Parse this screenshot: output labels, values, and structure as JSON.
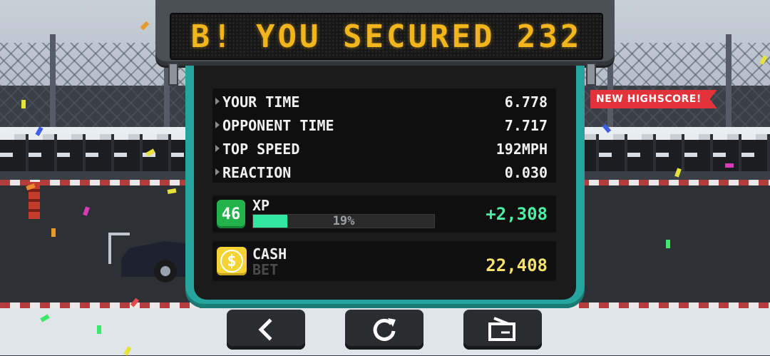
{
  "marquee": {
    "text": "B! YOU SECURED 232"
  },
  "stats": [
    {
      "label": "YOUR TIME",
      "value": "6.778"
    },
    {
      "label": "OPPONENT TIME",
      "value": "7.717"
    },
    {
      "label": "TOP SPEED",
      "value": "192MPH"
    },
    {
      "label": "REACTION",
      "value": "0.030"
    }
  ],
  "xp": {
    "level": "46",
    "label": "XP",
    "progress_text": "19%",
    "progress_fraction": 0.19,
    "gain": "+2,308"
  },
  "cash": {
    "icon_symbol": "$",
    "label": "CASH",
    "bet_label": "BET",
    "value": "22,408"
  },
  "highscore_banner": "NEW HIGHSCORE!",
  "buttons": [
    {
      "name": "back",
      "icon": "chevron-left-icon"
    },
    {
      "name": "restart",
      "icon": "refresh-icon"
    },
    {
      "name": "share",
      "icon": "share-card-icon"
    }
  ],
  "colors": {
    "panel_border": "#26a59e",
    "marquee_text": "#f3b51c",
    "xp_green": "#22b24c",
    "xp_fill": "#34e7a0",
    "cash_yellow": "#f6d334",
    "banner_red": "#e2333a"
  }
}
